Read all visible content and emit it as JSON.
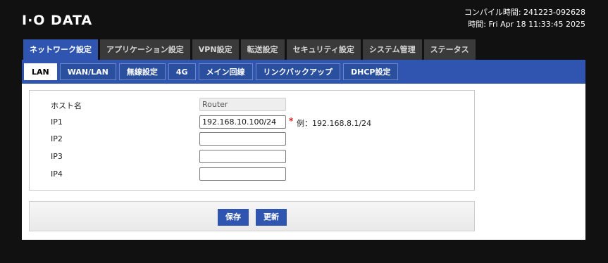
{
  "header": {
    "logo": "I·O DATA",
    "compile_time": "コンパイル時間: 241223-092628",
    "current_time": "時間: Fri Apr 18 11:33:45 2025"
  },
  "main_tabs": [
    {
      "label": "ネットワーク設定",
      "active": true
    },
    {
      "label": "アプリケーション設定",
      "active": false
    },
    {
      "label": "VPN設定",
      "active": false
    },
    {
      "label": "転送設定",
      "active": false
    },
    {
      "label": "セキュリティ設定",
      "active": false
    },
    {
      "label": "システム管理",
      "active": false
    },
    {
      "label": "ステータス",
      "active": false
    }
  ],
  "sub_tabs": [
    {
      "label": "LAN",
      "active": true
    },
    {
      "label": "WAN/LAN",
      "active": false
    },
    {
      "label": "無線設定",
      "active": false
    },
    {
      "label": "4G",
      "active": false
    },
    {
      "label": "メイン回線",
      "active": false
    },
    {
      "label": "リンクバックアップ",
      "active": false
    },
    {
      "label": "DHCP設定",
      "active": false
    }
  ],
  "form": {
    "hostname": {
      "label": "ホスト名",
      "value": "Router"
    },
    "ip1": {
      "label": "IP1",
      "value": "192.168.10.100/24",
      "required_mark": "*",
      "hint": "例：192.168.8.1/24"
    },
    "ip2": {
      "label": "IP2",
      "value": ""
    },
    "ip3": {
      "label": "IP3",
      "value": ""
    },
    "ip4": {
      "label": "IP4",
      "value": ""
    }
  },
  "buttons": {
    "save": "保存",
    "refresh": "更新"
  },
  "colors": {
    "accent": "#2f55b0",
    "background": "#111111",
    "inactive_tab": "#3a3a3a",
    "required": "#d62020"
  }
}
